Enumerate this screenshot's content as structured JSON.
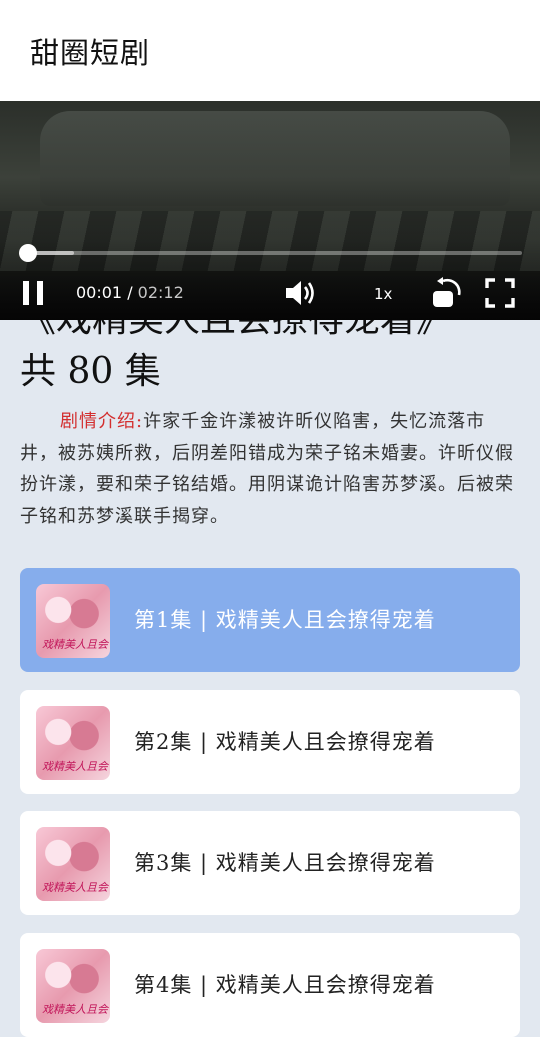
{
  "app": {
    "title": "甜圈短剧"
  },
  "player": {
    "current_time": "00:01",
    "separator": " / ",
    "duration": "02:12",
    "progress_fraction": 0.0076,
    "buffer_fraction": 0.1,
    "playback_rate": "1x"
  },
  "series": {
    "title_line": "《戏精美人且会撩得宠着》",
    "episodes_count": "共 80 集",
    "intro_label": "剧情介绍:",
    "intro_text": "许家千金许漾被许昕仪陷害，失忆流落市井，被苏姨所救，后阴差阳错成为荣子铭未婚妻。许昕仪假扮许漾，要和荣子铭结婚。用阴谋诡计陷害苏梦溪。后被荣子铭和苏梦溪联手揭穿。"
  },
  "episodes": [
    {
      "label": "第1集 | 戏精美人且会撩得宠着",
      "thumb_text": "戏精美人且会"
    },
    {
      "label": "第2集 | 戏精美人且会撩得宠着",
      "thumb_text": "戏精美人且会"
    },
    {
      "label": "第3集 | 戏精美人且会撩得宠着",
      "thumb_text": "戏精美人且会"
    },
    {
      "label": "第4集 | 戏精美人且会撩得宠着",
      "thumb_text": "戏精美人且会"
    }
  ],
  "colors": {
    "active_card": "#86adec",
    "intro_label": "#d32f2f"
  }
}
